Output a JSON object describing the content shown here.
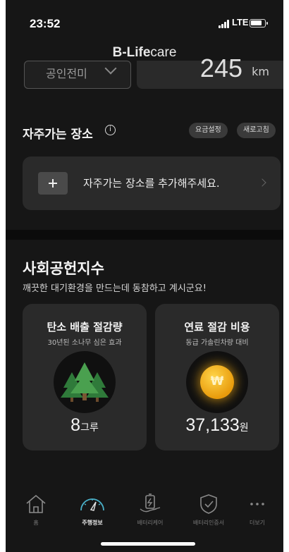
{
  "status_bar": {
    "time": "23:52",
    "network": "LTE"
  },
  "app": {
    "brand_prefix": "B-Life",
    "brand_suffix": "care"
  },
  "vehicle": {
    "selected": "공인전미"
  },
  "distance": {
    "value": "245",
    "unit": "km"
  },
  "frequent_places": {
    "title": "자주가는 장소",
    "fare_setting": "요금설정",
    "refresh": "새로고침",
    "add_message": "자주가는 장소를 추가해주세요."
  },
  "social": {
    "title": "사회공헌지수",
    "subtitle": "깨끗한 대기환경을 만드는데 동참하고 계시군요!",
    "carbon": {
      "title": "탄소 배출 절감량",
      "sub": "30년된 소나무 심은 효과",
      "value": "8",
      "unit": "그루"
    },
    "fuel": {
      "title": "연료 절감 비용",
      "sub": "동급 가솔린차량 대비",
      "value": "37,133",
      "unit": "원",
      "coin_symbol": "₩"
    }
  },
  "nav": {
    "items": [
      {
        "label": "홈",
        "icon": "home-icon"
      },
      {
        "label": "주행정보",
        "icon": "speedometer-icon",
        "active": true
      },
      {
        "label": "배터리케어",
        "icon": "battery-care-icon"
      },
      {
        "label": "배터리인증서",
        "icon": "shield-check-icon"
      },
      {
        "label": "더보기",
        "icon": "more-icon"
      }
    ]
  }
}
